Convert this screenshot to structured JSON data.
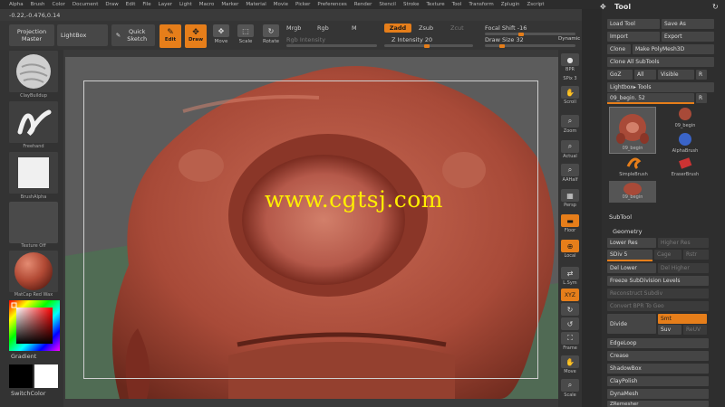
{
  "menu": [
    "Alpha",
    "Brush",
    "Color",
    "Document",
    "Draw",
    "Edit",
    "File",
    "Layer",
    "Light",
    "Macro",
    "Marker",
    "Material",
    "Movie",
    "Picker",
    "Preferences",
    "Render",
    "Stencil",
    "Stroke",
    "Texture",
    "Tool",
    "Transform",
    "Zplugin",
    "Zscript"
  ],
  "coords": "-0.22,-0.476,0.14",
  "toolbar": {
    "projection_master": "Projection Master",
    "lightbox": "LightBox",
    "quick_sketch": "Quick Sketch",
    "edit": "Edit",
    "draw": "Draw",
    "move": "Move",
    "scale": "Scale",
    "rotate": "Rotate",
    "mrgb": "Mrgb",
    "rgb": "Rgb",
    "m": "M",
    "rgb_intensity": "Rgb Intensity",
    "zadd": "Zadd",
    "zsub": "Zsub",
    "zcut": "Zcut",
    "z_intensity": "Z Intensity 20",
    "focal_shift": "Focal Shift -16",
    "draw_size": "Draw Size 32",
    "dynamic": "Dynamic"
  },
  "left_shelf": {
    "brush": "ClayBuildup",
    "stroke": "Freehand",
    "alpha": "BrushAlpha",
    "texture": "Texture Off",
    "material": "MatCap Red Wax",
    "gradient": "Gradient",
    "switch_color": "SwitchColor"
  },
  "viewport": {
    "watermark": "www.cgtsj.com"
  },
  "right_shelf": {
    "bpr": "BPR",
    "spix": "SPix 3",
    "scroll": "Scroll",
    "zoom": "Zoom",
    "actual": "Actual",
    "aahalf": "AAHalf",
    "persp": "Persp",
    "floor": "Floor",
    "local": "Local",
    "lsym": "L.Sym",
    "xyz": "XYZ",
    "frame": "Frame",
    "move": "Move",
    "scale": "Scale"
  },
  "tool_panel": {
    "title": "Tool",
    "load_tool": "Load Tool",
    "save_as": "Save As",
    "import": "Import",
    "export": "Export",
    "clone": "Clone",
    "make_polymesh": "Make PolyMesh3D",
    "clone_all": "Clone All SubTools",
    "goz": "GoZ",
    "all": "All",
    "visible": "Visible",
    "r": "R",
    "lightbox_tools": "Lightbox▸ Tools",
    "current_tool": "09_begin. 52",
    "tools": [
      "09_begin",
      "09_begin",
      "AlphaBrush",
      "SimpleBrush",
      "EraserBrush",
      "09_begin"
    ],
    "subtool": "SubTool",
    "geometry": "Geometry",
    "lower_res": "Lower Res",
    "higher_res": "Higher Res",
    "sdiv": "SDiv 5",
    "cage": "Cage",
    "rstr": "Rstr",
    "del_lower": "Del Lower",
    "del_higher": "Del Higher",
    "freeze": "Freeze SubDivision Levels",
    "reconstruct": "Reconstruct Subdiv",
    "convert_bpr": "Convert BPR To Geo",
    "divide": "Divide",
    "smt": "Smt",
    "suv": "Suv",
    "reuv": "ReUV",
    "edgeloop": "EdgeLoop",
    "crease": "Crease",
    "shadowbox": "ShadowBox",
    "claypolish": "ClayPolish",
    "dynamesh": "DynaMesh",
    "zremesher": "ZRemesher"
  }
}
